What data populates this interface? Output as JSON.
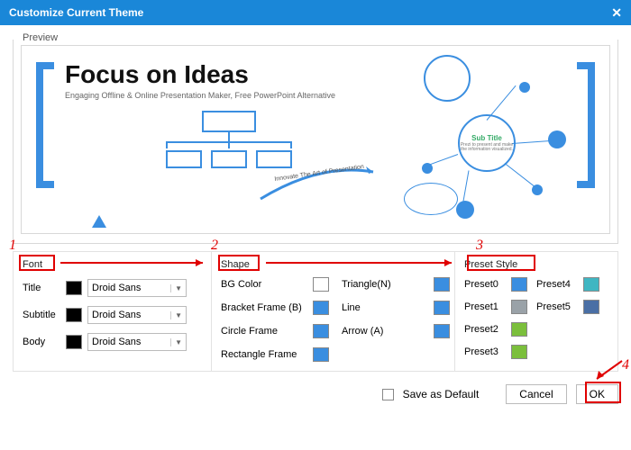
{
  "titlebar": {
    "title": "Customize Current Theme"
  },
  "preview": {
    "legend": "Preview",
    "headline": "Focus on Ideas",
    "subhead": "Engaging Offline & Online Presentation Maker, Free PowerPoint Alternative",
    "arrow_label": "Innovate The Art of Presentation",
    "mind": {
      "center_title": "Sub Title",
      "center_sub": "Prezi to present and make the information visualized."
    }
  },
  "panels": {
    "font": {
      "title": "Font",
      "rows": [
        {
          "label": "Title",
          "value": "Droid Sans"
        },
        {
          "label": "Subtitle",
          "value": "Droid Sans"
        },
        {
          "label": "Body",
          "value": "Droid Sans"
        }
      ]
    },
    "shape": {
      "title": "Shape",
      "col1": [
        "BG Color",
        "Bracket Frame (B)",
        "Circle Frame",
        "Rectangle Frame"
      ],
      "col2": [
        "Triangle(N)",
        "Line",
        "Arrow (A)"
      ]
    },
    "preset": {
      "title": "Preset Style",
      "col1": [
        "Preset0",
        "Preset1",
        "Preset2",
        "Preset3"
      ],
      "col2": [
        "Preset4",
        "Preset5"
      ]
    }
  },
  "footer": {
    "save_default": "Save as Default",
    "cancel": "Cancel",
    "ok": "OK"
  },
  "annotations": {
    "n1": "1",
    "n2": "2",
    "n3": "3",
    "n4": "4"
  }
}
